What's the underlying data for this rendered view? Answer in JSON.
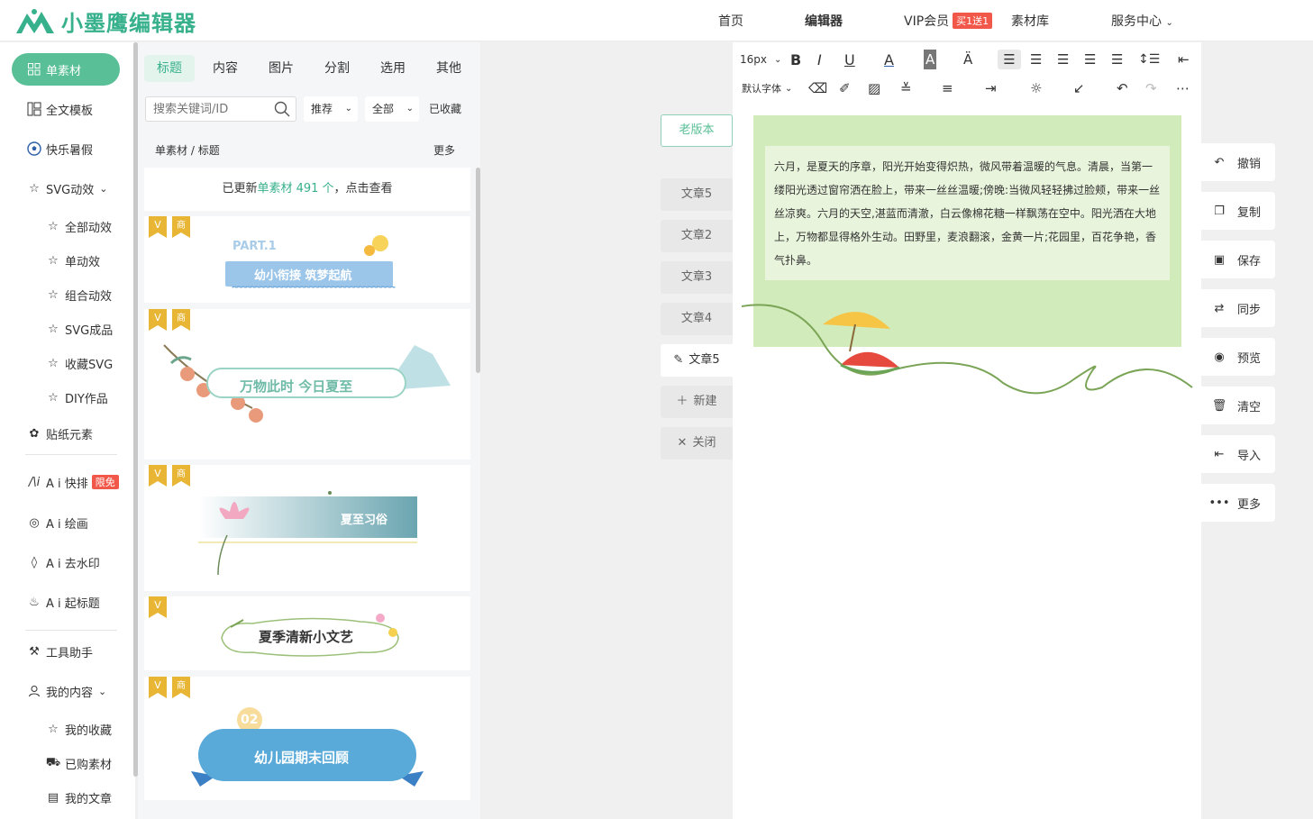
{
  "app": {
    "name": "小墨鹰编辑器"
  },
  "nav": {
    "home": "首页",
    "editor": "编辑器",
    "vip": "VIP会员",
    "vip_badge": "买1送1",
    "materials": "素材库",
    "service": "服务中心"
  },
  "sidebar": {
    "single": "单素材",
    "fulltemplate": "全文模板",
    "summer": "快乐暑假",
    "svg": "SVG动效",
    "svg_all": "全部动效",
    "svg_single": "单动效",
    "svg_group": "组合动效",
    "svg_product": "SVG成品",
    "svg_fav": "收藏SVG",
    "diy": "DIY作品",
    "sticker": "贴纸元素",
    "ai_layout": "A i 快排",
    "ai_layout_badge": "限免",
    "ai_draw": "A i 绘画",
    "ai_watermark": "A i 去水印",
    "ai_title": "A i 起标题",
    "tools": "工具助手",
    "mycontent": "我的内容",
    "my_fav": "我的收藏",
    "my_bought": "已购素材",
    "my_articles": "我的文章"
  },
  "panel": {
    "tabs": [
      "标题",
      "内容",
      "图片",
      "分割",
      "选用",
      "其他"
    ],
    "search_placeholder": "搜索关键词/ID",
    "filter_sort": "推荐",
    "filter_scope": "全部",
    "filter_fav": "已收藏",
    "breadcrumb_1": "单素材",
    "breadcrumb_sep": "/",
    "breadcrumb_2": "标题",
    "more": "更多",
    "update_prefix": "已更新",
    "update_link": "单素材 491 个",
    "update_suffix": "，点击查看",
    "cards": [
      {
        "line1": "PART.1",
        "line2": "幼小衔接 筑梦起航"
      },
      {
        "line1": "万物此时 今日夏至"
      },
      {
        "line1": "夏至习俗"
      },
      {
        "line1": "夏季清新小文艺"
      },
      {
        "line1": "02",
        "line2": "幼儿园期末回顾"
      }
    ],
    "vip_mark": "V",
    "biz_mark": "商"
  },
  "articles": {
    "old_version": "老版本",
    "tabs": [
      "文章5",
      "文章2",
      "文章3",
      "文章4",
      "文章5"
    ],
    "new": "新建",
    "close": "关闭"
  },
  "toolbar": {
    "font_size": "16px",
    "font_family": "默认字体"
  },
  "editor": {
    "body": "六月，是夏天的序章，阳光开始变得炽热，微风带着温暖的气息。清晨，当第一缕阳光透过窗帘洒在脸上，带来一丝丝温暖;傍晚:当微风轻轻拂过脸颊，带来一丝丝凉爽。六月的天空,湛蓝而清澈，白云像棉花糖一样飘荡在空中。阳光洒在大地上，万物都显得格外生动。田野里，麦浪翻滚，金黄一片;花园里，百花争艳，香气扑鼻。"
  },
  "actions": [
    "撤销",
    "复制",
    "保存",
    "同步",
    "预览",
    "清空",
    "导入",
    "更多"
  ],
  "colors": {
    "brand": "#37b08c",
    "active_green": "#59bf96",
    "canvas": "#d2ebba",
    "badge_red": "#f2584a"
  }
}
